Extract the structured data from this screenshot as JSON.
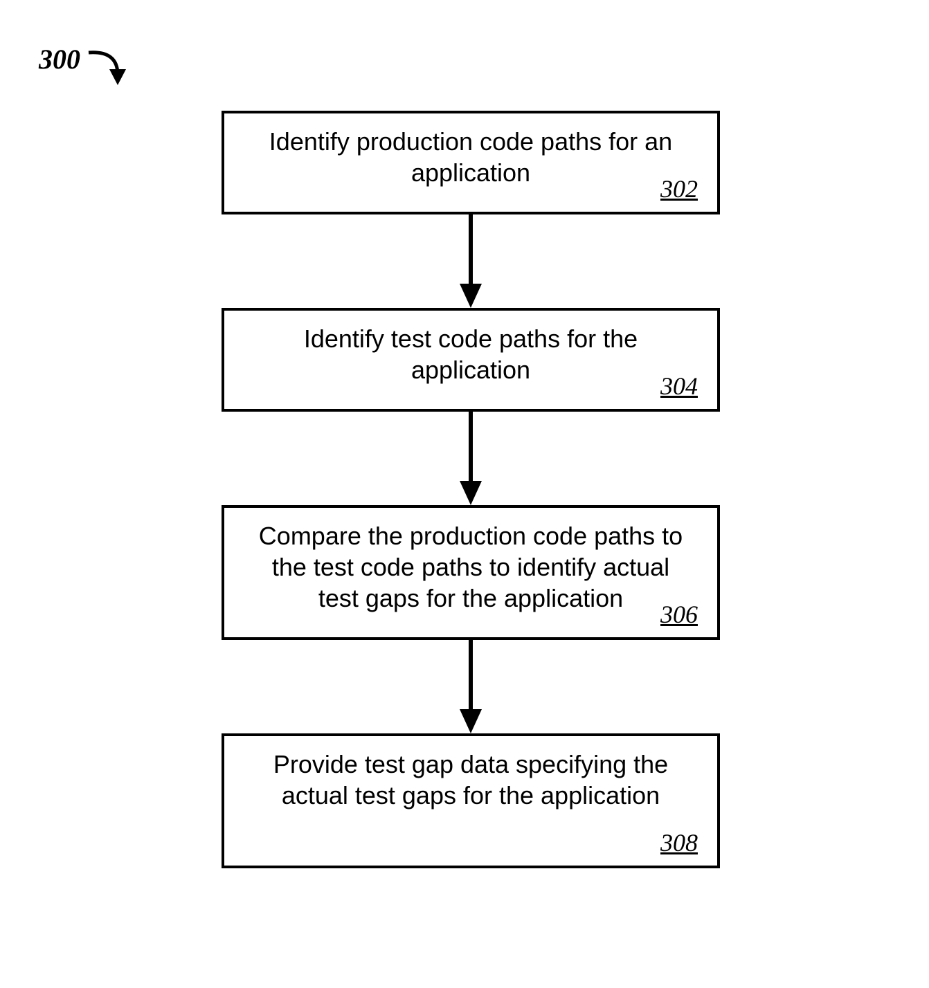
{
  "diagram": {
    "figure_label": "300",
    "boxes": [
      {
        "text": "Identify production code paths for an application",
        "ref": "302"
      },
      {
        "text": "Identify test code paths for the application",
        "ref": "304"
      },
      {
        "text": "Compare the production code paths to the test code paths to identify actual test gaps for the application",
        "ref": "306"
      },
      {
        "text": "Provide test gap data specifying the actual test gaps for the application",
        "ref": "308"
      }
    ]
  }
}
